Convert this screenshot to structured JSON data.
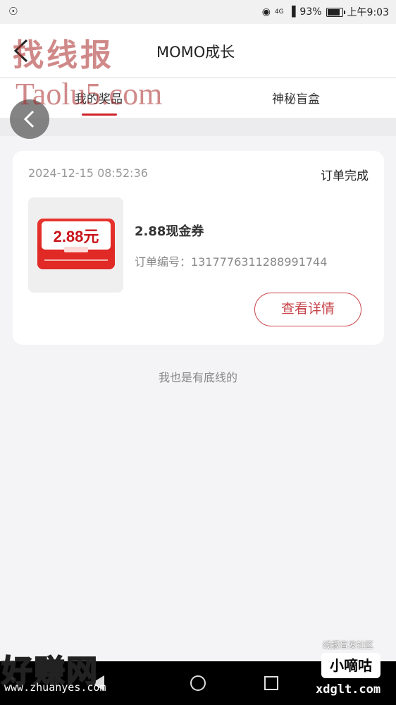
{
  "status_bar": {
    "battery": "93%",
    "time": "上午9:03",
    "network": "4G"
  },
  "header": {
    "title": "MOMO成长"
  },
  "tabs": [
    {
      "label": "我的奖品",
      "active": true
    },
    {
      "label": "神秘盲盒",
      "active": false
    }
  ],
  "order": {
    "time": "2024-12-15 08:52:36",
    "status": "订单完成",
    "coupon_amount": "2.88元",
    "prize_name": "2.88现金券",
    "order_no": "订单编号：1317776311288991744",
    "detail_button": "查看详情"
  },
  "footer_note": "我也是有底线的",
  "watermarks": {
    "top": "找线报",
    "taolu": "Taolu5.com",
    "haozhuan": "好赚网",
    "zhuanyes": "www.zhuanyes.com",
    "community": "线报盲发社区",
    "badge": "小嘀咕",
    "xdglt": "xdglt.com"
  },
  "colors": {
    "accent": "#d0232b",
    "button_border": "#c8454a"
  }
}
